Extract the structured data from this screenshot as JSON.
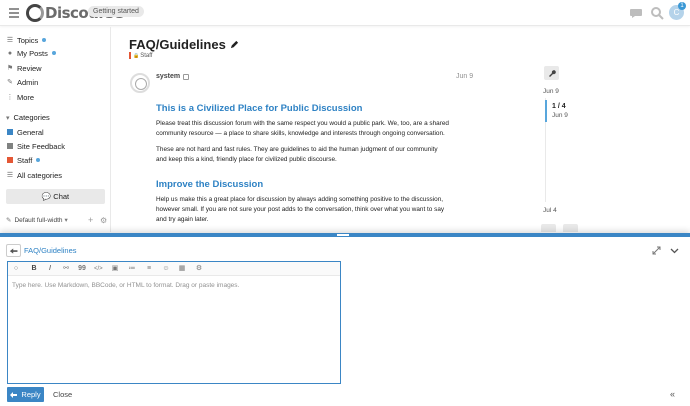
{
  "header": {
    "logo_text": "Discourse",
    "badge": "Getting started",
    "avatar_letter": "C",
    "notification_count": "1",
    "icons": [
      "hamburger-icon",
      "chat-bubble-icon",
      "search-icon"
    ]
  },
  "sidebar": {
    "items": [
      {
        "label": "Topics",
        "icon": "list-icon"
      },
      {
        "label": "My Posts",
        "icon": "user-icon"
      },
      {
        "label": "Review",
        "icon": "flag-icon"
      },
      {
        "label": "Admin",
        "icon": "wrench-icon"
      },
      {
        "label": "More",
        "icon": "more-icon"
      }
    ],
    "categories_heading": "Categories",
    "categories": [
      {
        "label": "General",
        "color": "#3b86c5"
      },
      {
        "label": "Site Feedback",
        "color": "#808281"
      },
      {
        "label": "Staff",
        "color": "#e45735"
      },
      {
        "label": "All categories",
        "color": ""
      }
    ],
    "chat_label": "Chat",
    "footer_label": "Default full-width"
  },
  "topic": {
    "title": "FAQ/Guidelines",
    "category": "Staff",
    "post": {
      "username": "system",
      "date": "Jun 9",
      "heading1": "This is a Civilized Place for Public Discussion",
      "para1_line1": "Please treat this discussion forum with the same respect you would a public park. We, too, are a shared",
      "para1_line2": "community resource — a place to share skills, knowledge and interests through ongoing conversation.",
      "para2_line1": "These are not hard and fast rules. They are guidelines to aid the human judgment of our community",
      "para2_line2": "and keep this a kind, friendly place for civilized public discourse.",
      "heading2": "Improve the Discussion",
      "para3_line1": "Help us make this a great place for discussion by always adding something positive to the discussion,",
      "para3_line2": "however small. If you are not sure your post adds to the conversation, think over what you want to say",
      "para3_line3": "and try again later."
    }
  },
  "timeline": {
    "start": "Jun 9",
    "position": "1 / 4",
    "position_date": "Jun 9",
    "end": "Jul 4"
  },
  "composer": {
    "title": "FAQ/Guidelines",
    "placeholder": "Type here. Use Markdown, BBCode, or HTML to format. Drag or paste images.",
    "toolbar": {
      "bold": "B",
      "italic": "I",
      "quote": "99",
      "code": "</>"
    },
    "reply_label": "Reply",
    "close_label": "Close",
    "accent": "#3b86c5"
  }
}
